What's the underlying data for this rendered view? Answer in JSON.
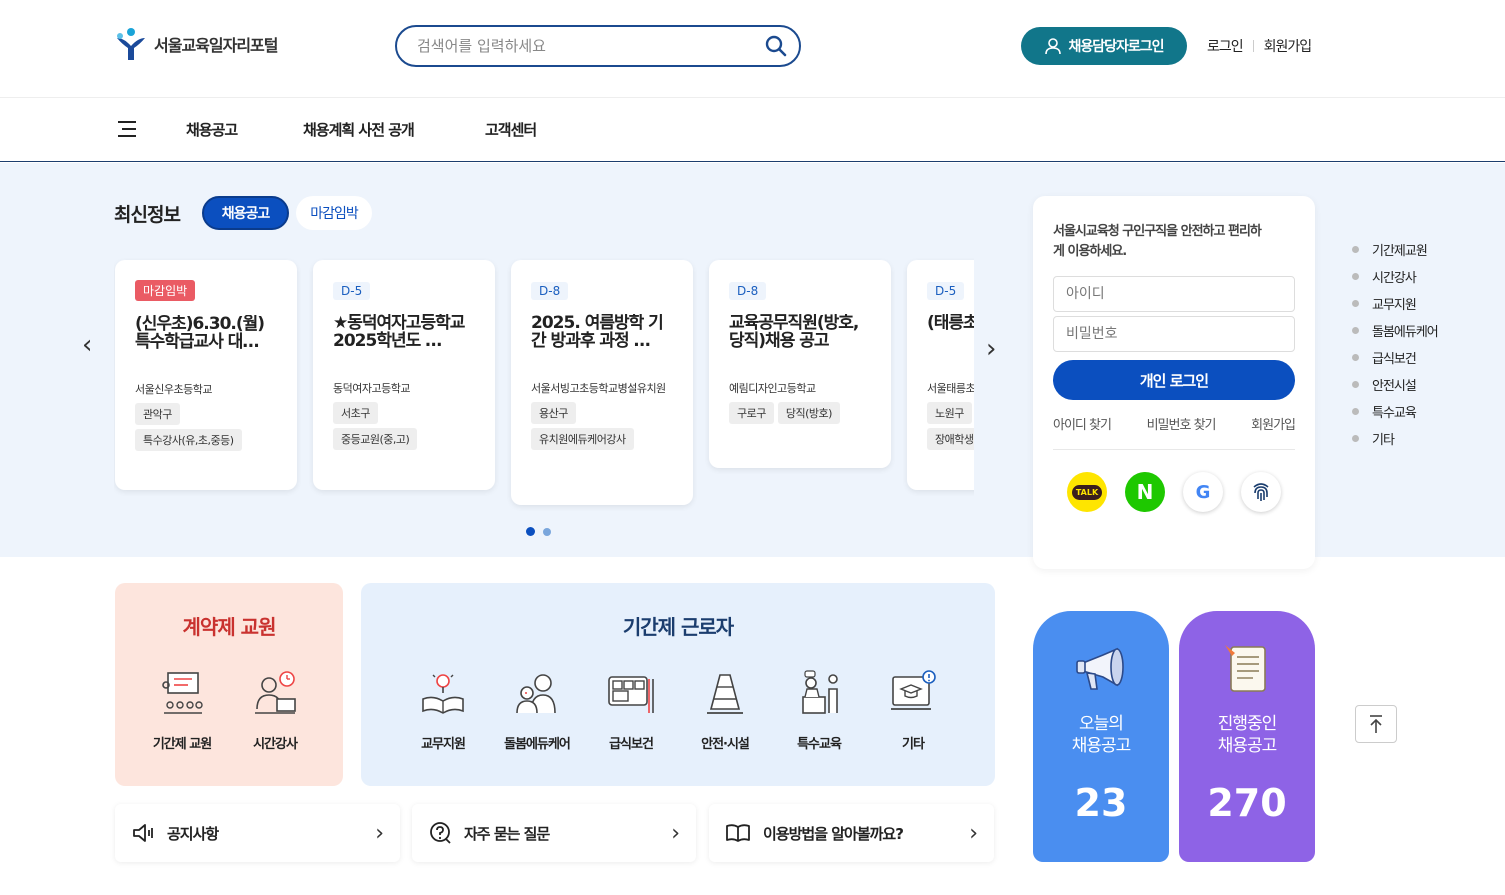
{
  "header": {
    "logo_text": "서울교육일자리포털",
    "search_placeholder": "검색어를 입력하세요",
    "recruiter_login": "채용담당자로그인",
    "login": "로그인",
    "signup": "회원가입"
  },
  "nav": {
    "items": [
      "채용공고",
      "채용계획 사전 공개",
      "고객센터"
    ]
  },
  "latest": {
    "title": "최신정보",
    "tabs": [
      "채용공고",
      "마감임박"
    ],
    "active_tab": "채용공고",
    "cards": [
      {
        "badge": "마감임박",
        "title": "(신우초)6.30.(월) 특수학급교사 대…",
        "school": "서울신우초등학교",
        "tags": [
          "관악구",
          "특수강사(유,초,중등)"
        ]
      },
      {
        "badge": "D-5",
        "title": "★동덕여자고등학교 2025학년도 …",
        "school": "동덕여자고등학교",
        "tags": [
          "서초구",
          "중등교원(중,고)"
        ]
      },
      {
        "badge": "D-8",
        "title": "2025. 여름방학 기간 방과후 과정 …",
        "school": "서울서빙고초등학교병설유치원",
        "tags": [
          "용산구",
          "유치원에듀케어강사"
        ]
      },
      {
        "badge": "D-8",
        "title": "교육공무직원(방호,당직)채용 공고",
        "school": "예림디자인고등학교",
        "tags": [
          "구로구",
          "당직(방호)"
        ]
      },
      {
        "badge": "D-5",
        "title": "(태릉초 대상학",
        "school": "서울태릉초",
        "tags": [
          "노원구",
          "장애학생"
        ]
      }
    ]
  },
  "login_box": {
    "message": "서울시교육청 구인구직을 안전하고 편리하게 이용하세요.",
    "id_placeholder": "아이디",
    "pw_placeholder": "비밀번호",
    "login_button": "개인 로그인",
    "find_id": "아이디 찾기",
    "find_pw": "비밀번호 찾기",
    "signup": "회원가입",
    "social": {
      "kakao": "TALK",
      "naver": "N",
      "google": "G"
    }
  },
  "side_menu": [
    "기간제교원",
    "시간강사",
    "교무지원",
    "돌봄에듀케어",
    "급식보건",
    "안전시설",
    "특수교육",
    "기타"
  ],
  "contract": {
    "title": "계약제 교원",
    "items": [
      "기간제 교원",
      "시간강사"
    ]
  },
  "period": {
    "title": "기간제 근로자",
    "items": [
      "교무지원",
      "돌봄에듀케어",
      "급식보건",
      "안전·시설",
      "특수교육",
      "기타"
    ]
  },
  "quick_links": [
    "공지사항",
    "자주 묻는 질문",
    "이용방법을 알아볼까요?"
  ],
  "stats": {
    "today_label": "오늘의\n채용공고",
    "today_value": "23",
    "ongoing_label": "진행중인\n채용공고",
    "ongoing_value": "270"
  },
  "colors": {
    "primary": "#0b4fbf",
    "recruiter": "#11768a",
    "hot": "#ea5b64",
    "stat_today": "#4a8ef0",
    "stat_ongoing": "#8e63e6"
  }
}
